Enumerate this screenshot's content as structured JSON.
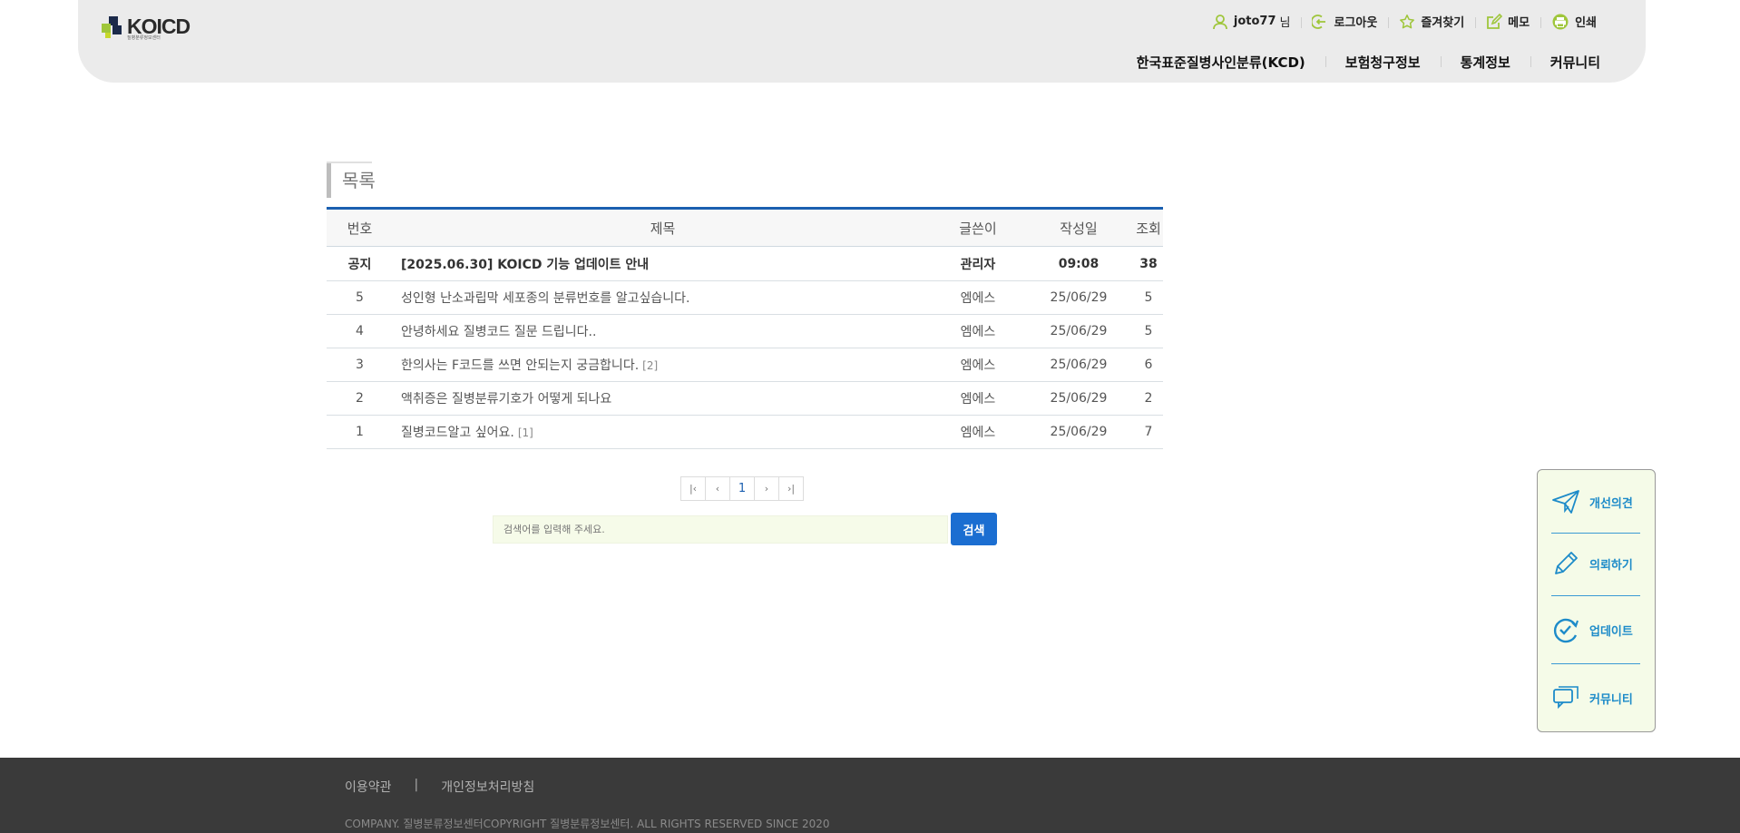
{
  "header": {
    "logo_text": "KOICD",
    "logo_sub": "질병분류정보센터",
    "util": {
      "user_id": "joto77",
      "user_suffix": "님",
      "logout": "로그아웃",
      "favorites": "즐겨찾기",
      "memo": "메모",
      "print": "인쇄"
    },
    "nav": [
      "한국표준질병사인분류(KCD)",
      "보험청구정보",
      "통계정보",
      "커뮤니티"
    ]
  },
  "board": {
    "title": "목록",
    "columns": {
      "no": "번호",
      "title": "제목",
      "writer": "글쓴이",
      "date": "작성일",
      "hits": "조회"
    },
    "notice": {
      "no": "공지",
      "title": "[2025.06.30] KOICD 기능 업데이트 안내",
      "writer": "관리자",
      "date": "09:08",
      "hits": "38"
    },
    "rows": [
      {
        "no": "5",
        "title": "성인형 난소과립막 세포종의 분류번호를 알고싶습니다.",
        "comments": "",
        "writer": "엠에스",
        "date": "25/06/29",
        "hits": "5"
      },
      {
        "no": "4",
        "title": "안녕하세요 질병코드 질문 드립니다..",
        "comments": "",
        "writer": "엠에스",
        "date": "25/06/29",
        "hits": "5"
      },
      {
        "no": "3",
        "title": "한의사는 F코드를 쓰면 안되는지 궁금합니다.",
        "comments": "[2]",
        "writer": "엠에스",
        "date": "25/06/29",
        "hits": "6"
      },
      {
        "no": "2",
        "title": "액취증은 질병분류기호가 어떻게 되나요",
        "comments": "",
        "writer": "엠에스",
        "date": "25/06/29",
        "hits": "2"
      },
      {
        "no": "1",
        "title": "질병코드알고 싶어요.",
        "comments": "[1]",
        "writer": "엠에스",
        "date": "25/06/29",
        "hits": "7"
      }
    ]
  },
  "pager": {
    "first": "|‹",
    "prev": "‹",
    "current": "1",
    "next": "›",
    "last": "›|"
  },
  "search": {
    "placeholder": "검색어를 입력해 주세요.",
    "button": "검색"
  },
  "quick": {
    "items": [
      {
        "label": "개선의견",
        "icon": "paper-plane-icon"
      },
      {
        "label": "의뢰하기",
        "icon": "pencil-icon"
      },
      {
        "label": "업데이트",
        "icon": "refresh-check-icon"
      },
      {
        "label": "커뮤니티",
        "icon": "chat-bubbles-icon"
      }
    ]
  },
  "footer": {
    "terms": "이용약관",
    "separator": "|",
    "privacy": "개인정보처리방침",
    "copyright": "COMPANY. 질병분류정보센터COPYRIGHT 질병분류정보센터. ALL RIGHTS RESERVED SINCE 2020"
  },
  "colors": {
    "accent_blue": "#1b6ed1",
    "header_bg": "#ebebeb",
    "icon_green": "#9fc63b",
    "quick_blue": "#1d8bc9",
    "footer_bg": "#3a3a3a"
  }
}
